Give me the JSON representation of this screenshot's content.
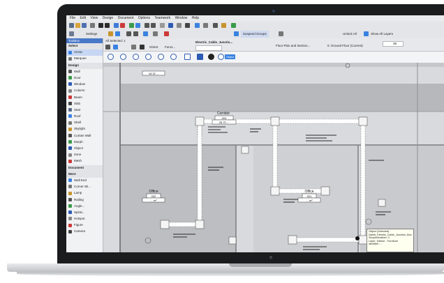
{
  "app": {
    "menus": [
      "File",
      "Edit",
      "View",
      "Design",
      "Document",
      "Options",
      "Teamwork",
      "Window",
      "Help"
    ],
    "toolbar2_labels": [
      "Settings",
      "Suspend Groups",
      "Unlock All",
      "Show All Layers"
    ],
    "infobox": {
      "selected_label": "All Selected: 1",
      "element_name": "Electric_Cable_Junctio...",
      "orient_label": "Orient",
      "func_label": "Funct..."
    },
    "floor_view": {
      "label": "Floor Plan and Section...",
      "story": "0. Ground Floor (Current)",
      "zoom": "36"
    },
    "quickbar": {
      "chip": "Object"
    }
  },
  "toolbox": {
    "title": "ToolBox",
    "items": [
      {
        "label": "Select",
        "section": true
      },
      {
        "label": "Arrow",
        "selected": true
      },
      {
        "label": "Marquee"
      },
      {
        "label": "Design",
        "section": true
      },
      {
        "label": "Wall"
      },
      {
        "label": "Door"
      },
      {
        "label": "Window"
      },
      {
        "label": "Column"
      },
      {
        "label": "Beam"
      },
      {
        "label": "Slab"
      },
      {
        "label": "Stair"
      },
      {
        "label": "Roof"
      },
      {
        "label": "Shell"
      },
      {
        "label": "Skylight"
      },
      {
        "label": "Curtain Wall"
      },
      {
        "label": "Morph"
      },
      {
        "label": "Object"
      },
      {
        "label": "Zone"
      },
      {
        "label": "Mesh"
      },
      {
        "label": "Document",
        "section": true
      },
      {
        "label": "More",
        "section": true
      },
      {
        "label": "Wall End"
      },
      {
        "label": "Corner Wi..."
      },
      {
        "label": "Lamp"
      },
      {
        "label": "Railing"
      },
      {
        "label": "Angle..."
      },
      {
        "label": "Spiral..."
      },
      {
        "label": "Hotspot"
      },
      {
        "label": "Figure"
      },
      {
        "label": "Camera"
      }
    ]
  },
  "plan": {
    "zones": [
      {
        "name": "Corridor",
        "id": "003",
        "area": "26.70 ..."
      },
      {
        "name": "Office",
        "id": "002",
        "area": "... m²"
      },
      {
        "name": "Office",
        "id": "001",
        "area": "... m²"
      },
      {
        "name": "",
        "id": "",
        "area": "18.32 ..."
      }
    ]
  },
  "tooltip": {
    "lines": [
      "Object (Selected)",
      "Name: Electric_Cable_Junction_Box",
      "Story/Elevation: 0.",
      "Layer: Interior - Furniture",
      "Identifier: ..."
    ]
  },
  "colors": {
    "accent": "#3a82e0",
    "toolbox_header": "#4a78c8",
    "canvas": "#d9dadd",
    "slab": "#b6b8bc"
  }
}
